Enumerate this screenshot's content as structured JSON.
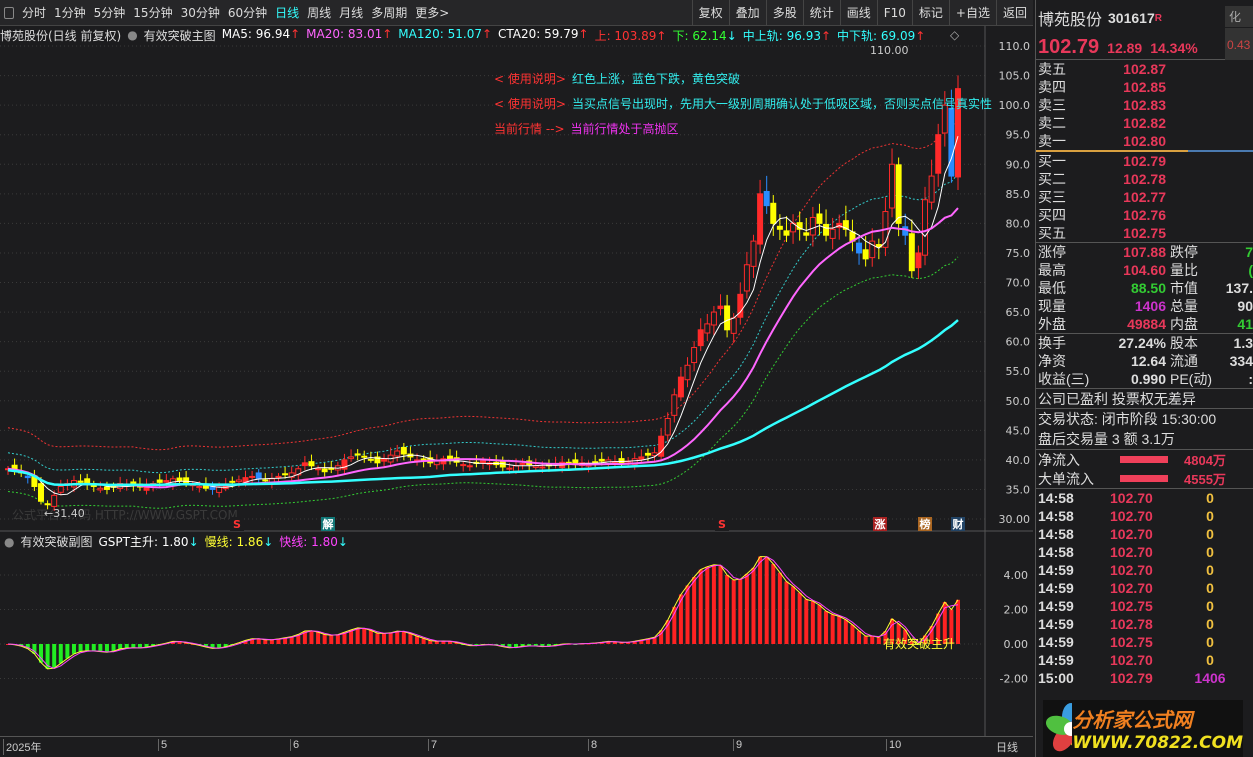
{
  "toolbar": {
    "periods": [
      "分时",
      "1分钟",
      "5分钟",
      "15分钟",
      "30分钟",
      "60分钟",
      "日线",
      "周线",
      "月线",
      "多周期",
      "更多>"
    ],
    "active": "日线",
    "tools": [
      "复权",
      "叠加",
      "多股",
      "统计",
      "画线",
      "F10",
      "标记",
      "+自选",
      "返回"
    ]
  },
  "legend": {
    "title": "博苑股份(日线 前复权)",
    "indicator": "有效突破主图",
    "items": [
      {
        "text": "MA5: 96.94",
        "arrow": "↑",
        "color": "#ffffff"
      },
      {
        "text": "MA20: 83.01",
        "arrow": "↑",
        "color": "#ff66ff"
      },
      {
        "text": "MA120: 51.07",
        "arrow": "↑",
        "color": "#33ffff"
      },
      {
        "text": "CTA20: 59.79",
        "arrow": "↑",
        "color": "#ffffff"
      },
      {
        "text": "上: 103.89",
        "arrow": "↑",
        "color": "#ff3333"
      },
      {
        "text": "下: 62.14",
        "arrow": "↓",
        "color": "#33ff33"
      },
      {
        "text": "中上轨: 96.93",
        "arrow": "↑",
        "color": "#33ffff"
      },
      {
        "text": "中下轨: 69.09",
        "arrow": "↑",
        "color": "#33ffff"
      }
    ]
  },
  "notes": [
    {
      "tag": "< 使用说明>",
      "text": "红色上涨，蓝色下跌，黄色突破"
    },
    {
      "tag": "< 使用说明>",
      "text": "当买点信号出现时，先用大一级别周期确认处于低吸区域，否则买点信号真实性"
    },
    {
      "tag": "当前行情 -->",
      "text": "当前行情处于高抛区"
    }
  ],
  "price_axis": [
    "110.0",
    "105.0",
    "100.0",
    "95.0",
    "90.0",
    "85.0",
    "80.0",
    "75.0",
    "70.0",
    "65.0",
    "60.0",
    "55.0",
    "50.0",
    "45.0",
    "40.0",
    "35.0",
    "30.00"
  ],
  "annotations": {
    "high": "110.00",
    "low": "←31.40",
    "watermark": "公式平台 ... 码 HTTP://WWW.GSPT.COM",
    "markers": [
      "S",
      "解",
      "S",
      "涨",
      "榜",
      "财"
    ]
  },
  "sub": {
    "title": "有效突破副图",
    "items": [
      {
        "text": "GSPT主升: 1.80",
        "arrow": "↓",
        "color": "#ffffff"
      },
      {
        "text": "慢线: 1.86",
        "arrow": "↓",
        "color": "#ffff33"
      },
      {
        "text": "快线: 1.80",
        "arrow": "↓",
        "color": "#ff44ff"
      }
    ],
    "axis": [
      "4.00",
      "2.00",
      "0.00",
      "-2.00"
    ],
    "signal": "有效突破主升"
  },
  "date_axis": {
    "labels": [
      "2025年",
      "5",
      "6",
      "7",
      "8",
      "9",
      "10"
    ],
    "period": "日线"
  },
  "colors": {
    "up": "#ff2a2a",
    "down": "#2a8cff",
    "breakout": "#ffff00",
    "ma5": "#ffffff",
    "ma20": "#ff66ff",
    "ma120": "#33ffff"
  },
  "chart_data": {
    "type": "candlestick",
    "closes": [
      38.5,
      38.2,
      37.8,
      37.0,
      35.5,
      33.0,
      32.5,
      34.0,
      35.5,
      36.0,
      36.5,
      36.2,
      35.8,
      35.5,
      35.2,
      35.0,
      35.5,
      36.0,
      35.8,
      35.6,
      35.4,
      35.8,
      36.0,
      36.2,
      36.5,
      36.8,
      36.4,
      36.0,
      35.8,
      35.5,
      35.2,
      35.0,
      35.4,
      35.8,
      36.2,
      36.6,
      37.0,
      37.2,
      36.8,
      36.5,
      36.8,
      37.2,
      37.5,
      37.8,
      38.5,
      39.5,
      39.0,
      38.5,
      38.0,
      38.4,
      39.0,
      40.0,
      40.5,
      41.0,
      40.5,
      40.0,
      39.5,
      40.2,
      40.8,
      41.5,
      41.0,
      40.5,
      40.0,
      39.8,
      39.5,
      39.8,
      40.2,
      40.0,
      39.6,
      39.2,
      39.0,
      39.4,
      39.8,
      39.5,
      39.2,
      38.8,
      38.6,
      39.0,
      39.4,
      39.2,
      39.0,
      38.8,
      39.0,
      39.3,
      39.6,
      39.4,
      39.2,
      39.5,
      39.4,
      39.6,
      39.8,
      40.0,
      39.7,
      39.5,
      39.8,
      40.2,
      40.5,
      40.8,
      41.2,
      44,
      47,
      51,
      54,
      56,
      59,
      62,
      63,
      65,
      66,
      62,
      64,
      68,
      73,
      77,
      85,
      83,
      80,
      79,
      78,
      80,
      79,
      78,
      81,
      80,
      78,
      79,
      80,
      79,
      77,
      75,
      74,
      77,
      76,
      82,
      90,
      80,
      78,
      72,
      75,
      84,
      88,
      95,
      100,
      88,
      102.79
    ],
    "ylim": [
      30,
      110
    ]
  },
  "quote": {
    "name": "博苑股份",
    "code": "301617",
    "flag": "R",
    "side": "化",
    "price": "102.79",
    "change": "12.89",
    "pct": "14.34%",
    "side_val": "0.43",
    "asks": [
      [
        "卖五",
        "102.87"
      ],
      [
        "卖四",
        "102.85"
      ],
      [
        "卖三",
        "102.83"
      ],
      [
        "卖二",
        "102.82"
      ],
      [
        "卖一",
        "102.80"
      ]
    ],
    "bids": [
      [
        "买一",
        "102.79"
      ],
      [
        "买二",
        "102.78"
      ],
      [
        "买三",
        "102.77"
      ],
      [
        "买四",
        "102.76"
      ],
      [
        "买五",
        "102.75"
      ]
    ],
    "stats": [
      [
        "涨停",
        "107.88",
        "#e8385a",
        "跌停",
        "7",
        "#3c3"
      ],
      [
        "最高",
        "104.60",
        "#e8385a",
        "量比",
        "(",
        "#3c3"
      ],
      [
        "最低",
        "88.50",
        "#3c3",
        "市值",
        "137.",
        "#ddd"
      ],
      [
        "现量",
        "1406",
        "#c3c",
        "总量",
        "90",
        "#ddd"
      ],
      [
        "外盘",
        "49884",
        "#e8385a",
        "内盘",
        "41",
        "#3c3"
      ]
    ],
    "stats2": [
      [
        "换手",
        "27.24%",
        "股本",
        "1.3"
      ],
      [
        "净资",
        "12.64",
        "流通",
        "334"
      ],
      [
        "收益(三)",
        "0.990",
        "PE(动)",
        ":"
      ]
    ],
    "info": [
      "公司已盈利 投票权无差异",
      "交易状态: 闭市阶段 15:30:00",
      "盘后交易量 3 额 3.1万"
    ],
    "flows": [
      [
        "净流入",
        "4804万"
      ],
      [
        "大单流入",
        "4555万"
      ]
    ],
    "trades": [
      [
        "14:58",
        "102.70",
        "0"
      ],
      [
        "14:58",
        "102.70",
        "0"
      ],
      [
        "14:58",
        "102.70",
        "0"
      ],
      [
        "14:58",
        "102.70",
        "0"
      ],
      [
        "14:59",
        "102.70",
        "0"
      ],
      [
        "14:59",
        "102.70",
        "0"
      ],
      [
        "14:59",
        "102.75",
        "0"
      ],
      [
        "14:59",
        "102.78",
        "0"
      ],
      [
        "14:59",
        "102.75",
        "0"
      ],
      [
        "14:59",
        "102.70",
        "0"
      ],
      [
        "15:00",
        "102.79",
        "1406"
      ]
    ]
  },
  "logo": {
    "title": "分析家公式网",
    "url": "WWW.70822.COM"
  }
}
